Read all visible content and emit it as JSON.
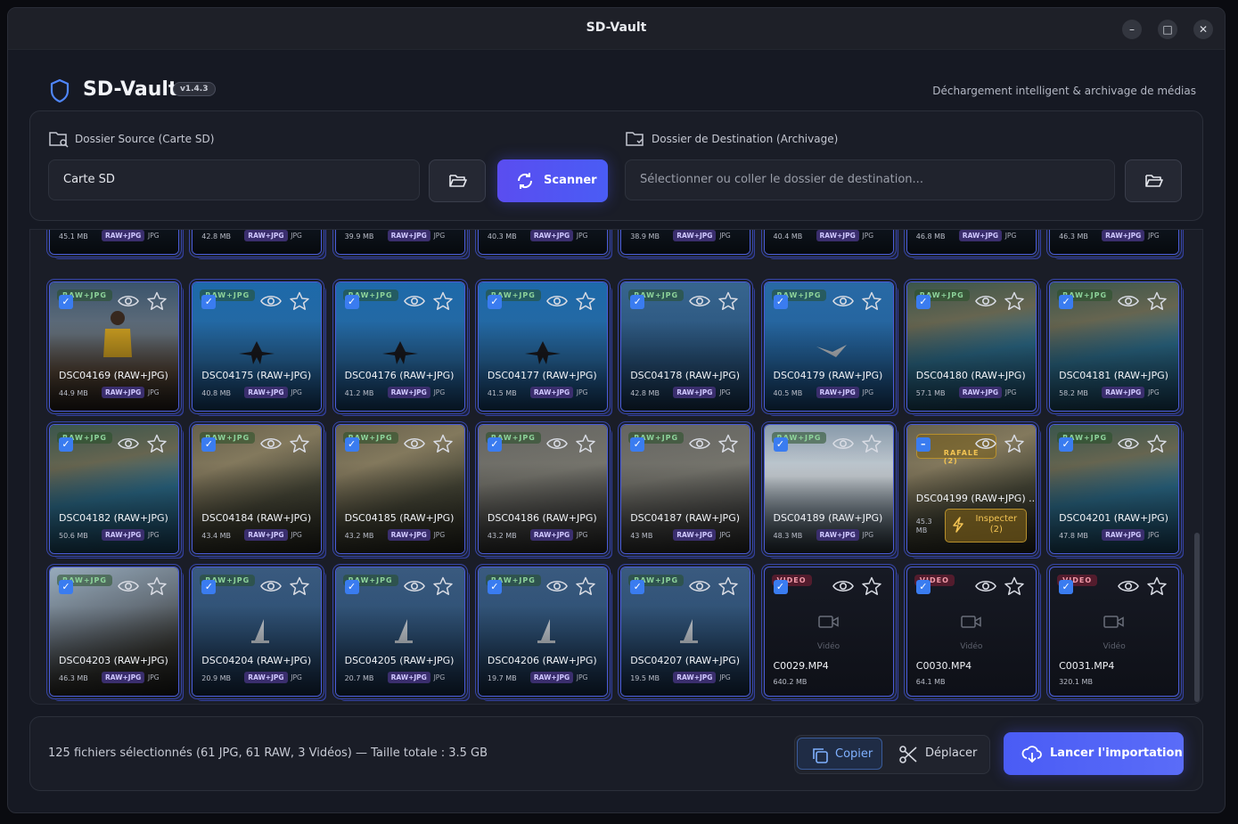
{
  "window": {
    "title": "SD-Vault",
    "minimize": "–",
    "maximize": "□",
    "close": "✕"
  },
  "header": {
    "app_name": "SD-Vault",
    "version": "v1.4.3",
    "tagline": "Déchargement intelligent & archivage de médias"
  },
  "source": {
    "label": "Dossier Source (Carte SD)",
    "value": "Carte SD",
    "browse_icon": "folder-open-icon",
    "scan_label": "Scanner"
  },
  "destination": {
    "label": "Dossier de Destination (Archivage)",
    "placeholder": "Sélectionner ou coller le dossier de destination...",
    "browse_icon": "folder-open-icon"
  },
  "common": {
    "raw_jpg": "RAW+JPG",
    "jpg": "JPG",
    "video_tag": "VIDEO",
    "video_label": "Vidéo"
  },
  "partial_row": [
    {
      "size": "45.1 MB"
    },
    {
      "size": "42.8 MB"
    },
    {
      "size": "39.9 MB"
    },
    {
      "size": "40.3 MB"
    },
    {
      "size": "38.9 MB"
    },
    {
      "size": "40.4 MB"
    },
    {
      "size": "46.8 MB"
    },
    {
      "size": "46.3 MB"
    }
  ],
  "rows": [
    [
      {
        "name": "DSC04169 (RAW+JPG)",
        "size": "44.9 MB",
        "scene": "person"
      },
      {
        "name": "DSC04175 (RAW+JPG)",
        "size": "40.8 MB",
        "scene": "plane"
      },
      {
        "name": "DSC04176 (RAW+JPG)",
        "size": "41.2 MB",
        "scene": "plane"
      },
      {
        "name": "DSC04177 (RAW+JPG)",
        "size": "41.5 MB",
        "scene": "plane"
      },
      {
        "name": "DSC04178 (RAW+JPG)",
        "size": "42.8 MB",
        "scene": "sky"
      },
      {
        "name": "DSC04179 (RAW+JPG)",
        "size": "40.5 MB",
        "scene": "bird"
      },
      {
        "name": "DSC04180 (RAW+JPG)",
        "size": "57.1 MB",
        "scene": "coast"
      },
      {
        "name": "DSC04181 (RAW+JPG)",
        "size": "58.2 MB",
        "scene": "coast"
      }
    ],
    [
      {
        "name": "DSC04182 (RAW+JPG)",
        "size": "50.6 MB",
        "scene": "coast"
      },
      {
        "name": "DSC04184 (RAW+JPG)",
        "size": "43.4 MB",
        "scene": "rock"
      },
      {
        "name": "DSC04185 (RAW+JPG)",
        "size": "43.2 MB",
        "scene": "rock"
      },
      {
        "name": "DSC04186 (RAW+JPG)",
        "size": "43.2 MB",
        "scene": "grey"
      },
      {
        "name": "DSC04187 (RAW+JPG)",
        "size": "43 MB",
        "scene": "grey"
      },
      {
        "name": "DSC04189 (RAW+JPG)",
        "size": "48.3 MB",
        "scene": "surf"
      },
      {
        "name": "DSC04199 (RAW+JPG) ...",
        "size": "45.3 MB",
        "scene": "rock",
        "burst": true,
        "burst_label": "RAFALE (2)",
        "inspect_label": "Inspecter (2)"
      },
      {
        "name": "DSC04201 (RAW+JPG)",
        "size": "47.8 MB",
        "scene": "coast"
      }
    ],
    [
      {
        "name": "DSC04203 (RAW+JPG)",
        "size": "46.3 MB",
        "scene": "cliff"
      },
      {
        "name": "DSC04204 (RAW+JPG)",
        "size": "20.9 MB",
        "scene": "sail"
      },
      {
        "name": "DSC04205 (RAW+JPG)",
        "size": "20.7 MB",
        "scene": "sail"
      },
      {
        "name": "DSC04206 (RAW+JPG)",
        "size": "19.7 MB",
        "scene": "sail"
      },
      {
        "name": "DSC04207 (RAW+JPG)",
        "size": "19.5 MB",
        "scene": "sail"
      },
      {
        "name": "C0029.MP4",
        "size": "640.2 MB",
        "video": true
      },
      {
        "name": "C0030.MP4",
        "size": "64.1 MB",
        "video": true
      },
      {
        "name": "C0031.MP4",
        "size": "320.1 MB",
        "video": true
      }
    ]
  ],
  "footer": {
    "status": "125 fichiers sélectionnés (61 JPG, 61 RAW, 3 Vidéos) — Taille totale : 3.5 GB",
    "copy_label": "Copier",
    "move_label": "Déplacer",
    "launch_label": "Lancer l'importation"
  },
  "colors": {
    "accent": "#4a5cf5",
    "check": "#3a7cf0",
    "burst": "#f3c453",
    "raw_badge": "#3a2e6d"
  }
}
